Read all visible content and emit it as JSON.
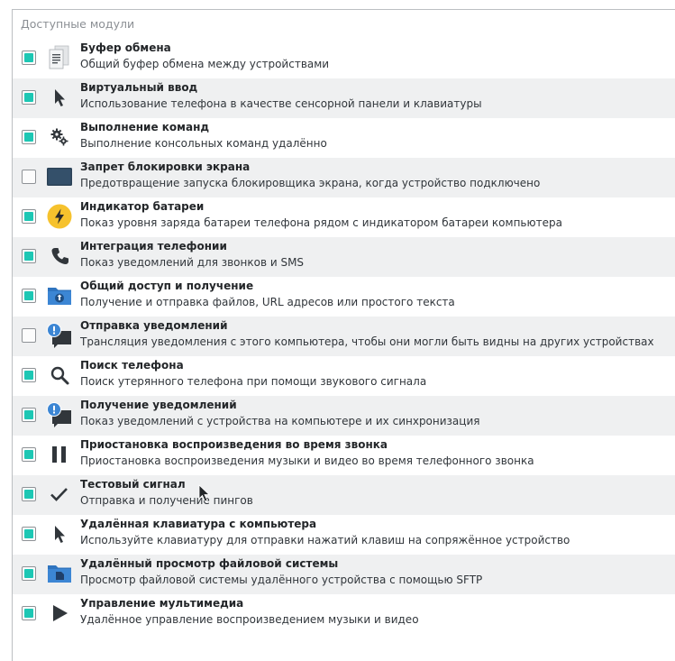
{
  "panel": {
    "title": "Доступные модули"
  },
  "modules": [
    {
      "name": "Буфер обмена",
      "description": "Общий буфер обмена между устройствами",
      "checked": true,
      "icon": "clipboard-icon"
    },
    {
      "name": "Виртуальный ввод",
      "description": "Использование телефона в качестве сенсорной панели и клавиатуры",
      "checked": true,
      "icon": "pointer-icon"
    },
    {
      "name": "Выполнение команд",
      "description": "Выполнение консольных команд удалённо",
      "checked": true,
      "icon": "gears-icon"
    },
    {
      "name": "Запрет блокировки экрана",
      "description": "Предотвращение запуска блокировщика экрана, когда устройство подключено",
      "checked": false,
      "icon": "screen-icon"
    },
    {
      "name": "Индикатор батареи",
      "description": "Показ уровня заряда батареи телефона рядом с индикатором батареи компьютера",
      "checked": true,
      "icon": "battery-bolt-icon"
    },
    {
      "name": "Интеграция телефонии",
      "description": "Показ уведомлений для звонков и SMS",
      "checked": true,
      "icon": "phone-icon"
    },
    {
      "name": "Общий доступ и получение",
      "description": "Получение и отправка файлов, URL адресов или простого текста",
      "checked": true,
      "icon": "shared-folder-icon"
    },
    {
      "name": "Отправка уведомлений",
      "description": "Трансляция уведомления с этого компьютера, чтобы они могли быть видны на других устройствах",
      "checked": false,
      "icon": "notification-icon"
    },
    {
      "name": "Поиск телефона",
      "description": "Поиск утерянного телефона при помощи звукового сигнала",
      "checked": true,
      "icon": "search-icon"
    },
    {
      "name": "Получение уведомлений",
      "description": "Показ уведомлений с устройства на компьютере и их синхронизация",
      "checked": true,
      "icon": "notification-icon"
    },
    {
      "name": "Приостановка воспроизведения во время звонка",
      "description": "Приостановка воспроизведения музыки и видео во время телефонного звонка",
      "checked": true,
      "icon": "pause-icon"
    },
    {
      "name": "Тестовый сигнал",
      "description": "Отправка и получение пингов",
      "checked": true,
      "icon": "checkmark-icon"
    },
    {
      "name": "Удалённая клавиатура с компьютера",
      "description": "Используйте клавиатуру для отправки нажатий клавиш на сопряжённое устройство",
      "checked": true,
      "icon": "pointer-icon"
    },
    {
      "name": "Удалённый просмотр файловой системы",
      "description": "Просмотр файловой системы удалённого устройства с помощью SFTP",
      "checked": true,
      "icon": "remote-folder-icon"
    },
    {
      "name": "Управление мультимедиа",
      "description": "Удалённое управление воспроизведением музыки и видео",
      "checked": true,
      "icon": "play-icon"
    }
  ],
  "colors": {
    "checkbox_fill": "#1dc7b4",
    "alt_row": "#eff0f1",
    "battery": "#f6c22d",
    "folder": "#3c86d4",
    "screen": "#2c4257"
  }
}
